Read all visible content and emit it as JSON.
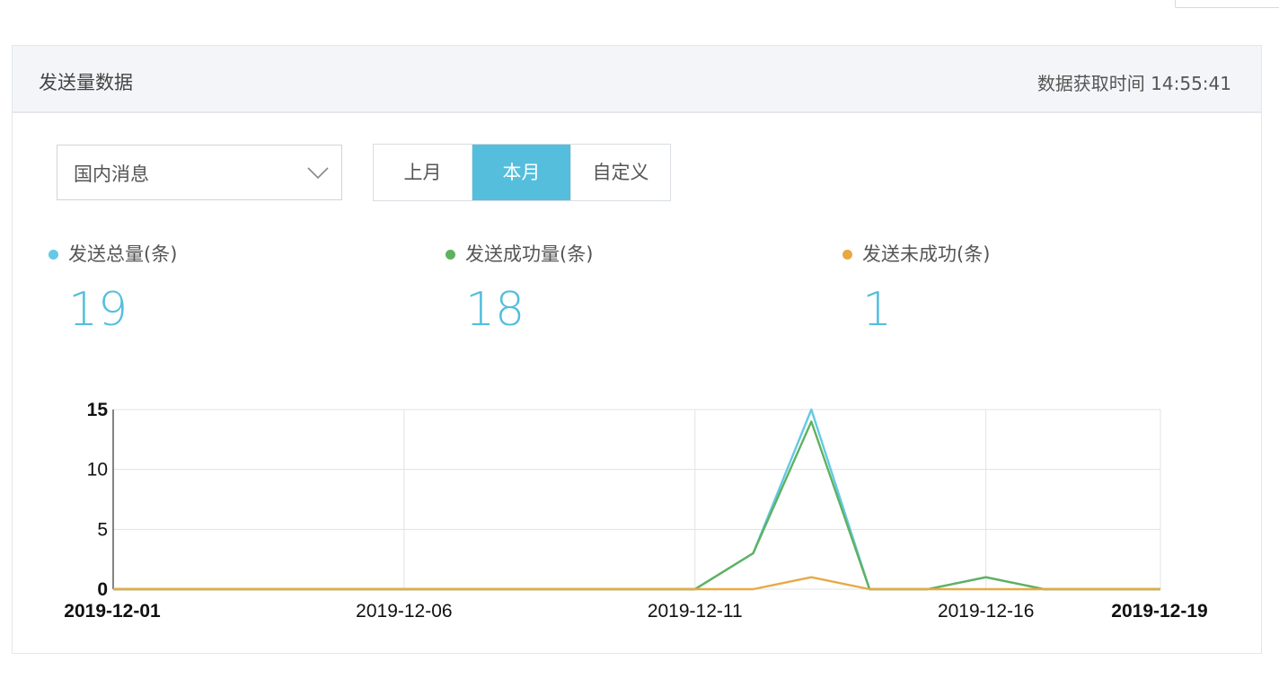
{
  "panel": {
    "title": "发送量数据",
    "fetch_time": "数据获取时间 14:55:41"
  },
  "filter": {
    "message_type": "国内消息",
    "periods": [
      {
        "label": "上月",
        "active": false
      },
      {
        "label": "本月",
        "active": true
      },
      {
        "label": "自定义",
        "active": false
      }
    ]
  },
  "stats": [
    {
      "label": "发送总量(条)",
      "value": "19",
      "dot_color": "#63c9e6"
    },
    {
      "label": "发送成功量(条)",
      "value": "18",
      "dot_color": "#5fb15f"
    },
    {
      "label": "发送未成功(条)",
      "value": "1",
      "dot_color": "#e8a945"
    }
  ],
  "colors": {
    "accent": "#54bedc",
    "grid": "#e3e3e3"
  },
  "chart_data": {
    "type": "line",
    "x": [
      "2019-12-01",
      "2019-12-02",
      "2019-12-03",
      "2019-12-04",
      "2019-12-05",
      "2019-12-06",
      "2019-12-07",
      "2019-12-08",
      "2019-12-09",
      "2019-12-10",
      "2019-12-11",
      "2019-12-12",
      "2019-12-13",
      "2019-12-14",
      "2019-12-15",
      "2019-12-16",
      "2019-12-17",
      "2019-12-18",
      "2019-12-19"
    ],
    "x_tick_labels": [
      "2019-12-01",
      "2019-12-06",
      "2019-12-11",
      "2019-12-16",
      "2019-12-19"
    ],
    "y_tick_labels": [
      "15",
      "10",
      "5",
      "0"
    ],
    "ylim": [
      0,
      15
    ],
    "grid": true,
    "series": [
      {
        "key": "total",
        "color": "#63c9e6",
        "values": [
          0,
          0,
          0,
          0,
          0,
          0,
          0,
          0,
          0,
          0,
          0,
          3,
          15,
          0,
          0,
          1,
          0,
          0,
          0
        ]
      },
      {
        "key": "success",
        "color": "#5fb15f",
        "values": [
          0,
          0,
          0,
          0,
          0,
          0,
          0,
          0,
          0,
          0,
          0,
          3,
          14,
          0,
          0,
          1,
          0,
          0,
          0
        ]
      },
      {
        "key": "failed",
        "color": "#e8a945",
        "values": [
          0,
          0,
          0,
          0,
          0,
          0,
          0,
          0,
          0,
          0,
          0,
          0,
          1,
          0,
          0,
          0,
          0,
          0,
          0
        ]
      }
    ]
  }
}
